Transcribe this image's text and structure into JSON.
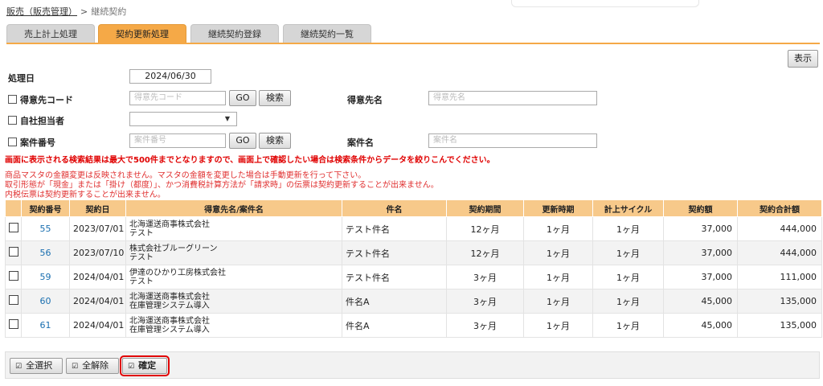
{
  "breadcrumb": {
    "parent": "販売（販売管理）",
    "separator": ">",
    "current": "継続契約"
  },
  "tabs": [
    {
      "label": "売上計上処理"
    },
    {
      "label": "契約更新処理"
    },
    {
      "label": "継続契約登録"
    },
    {
      "label": "継続契約一覧"
    }
  ],
  "display_button": "表示",
  "form": {
    "date_label": "処理日",
    "date_value": "2024/06/30",
    "customer_code_label": "得意先コード",
    "customer_code_placeholder": "得意先コード",
    "customer_name_label": "得意先名",
    "customer_name_placeholder": "得意先名",
    "staff_label": "自社担当者",
    "project_no_label": "案件番号",
    "project_no_placeholder": "案件番号",
    "project_name_label": "案件名",
    "project_name_placeholder": "案件名",
    "go_label": "GO",
    "search_label": "検索"
  },
  "messages": {
    "warning": "画面に表示される検索結果は最大で500件までとなりますので、画面上で確認したい場合は検索条件からデータを絞りこんでください。",
    "note1": "商品マスタの金額変更は反映されません。マスタの金額を変更した場合は手動更新を行って下さい。",
    "note2": "取引形態が「現金」または「掛け（都度）」、かつ消費税計算方法が「請求時」の伝票は契約更新することが出来ません。",
    "note3": "内税伝票は契約更新することが出来ません。"
  },
  "table": {
    "headers": [
      "",
      "契約番号",
      "契約日",
      "得意先名/案件名",
      "件名",
      "契約期間",
      "更新時期",
      "計上サイクル",
      "契約額",
      "契約合計額"
    ],
    "rows": [
      {
        "no": "55",
        "date": "2023/07/01",
        "customer": "北海運送商事株式会社",
        "project": "テスト",
        "subject": "テスト件名",
        "period": "12ヶ月",
        "renewal": "1ヶ月",
        "cycle": "1ヶ月",
        "amount": "37,000",
        "total": "444,000"
      },
      {
        "no": "56",
        "date": "2023/07/10",
        "customer": "株式会社ブルーグリーン",
        "project": "テスト",
        "subject": "テスト件名",
        "period": "12ヶ月",
        "renewal": "1ヶ月",
        "cycle": "1ヶ月",
        "amount": "37,000",
        "total": "444,000"
      },
      {
        "no": "59",
        "date": "2024/04/01",
        "customer": "伊達のひかり工房株式会社",
        "project": "テスト",
        "subject": "テスト件名",
        "period": "3ヶ月",
        "renewal": "1ヶ月",
        "cycle": "1ヶ月",
        "amount": "37,000",
        "total": "111,000"
      },
      {
        "no": "60",
        "date": "2024/04/01",
        "customer": "北海運送商事株式会社",
        "project": "在庫管理システム導入",
        "subject": "件名A",
        "period": "3ヶ月",
        "renewal": "1ヶ月",
        "cycle": "1ヶ月",
        "amount": "45,000",
        "total": "135,000"
      },
      {
        "no": "61",
        "date": "2024/04/01",
        "customer": "北海運送商事株式会社",
        "project": "在庫管理システム導入",
        "subject": "件名A",
        "period": "3ヶ月",
        "renewal": "1ヶ月",
        "cycle": "1ヶ月",
        "amount": "45,000",
        "total": "135,000"
      }
    ]
  },
  "footer": {
    "select_all": "全選択",
    "deselect_all": "全解除",
    "confirm": "確定"
  }
}
